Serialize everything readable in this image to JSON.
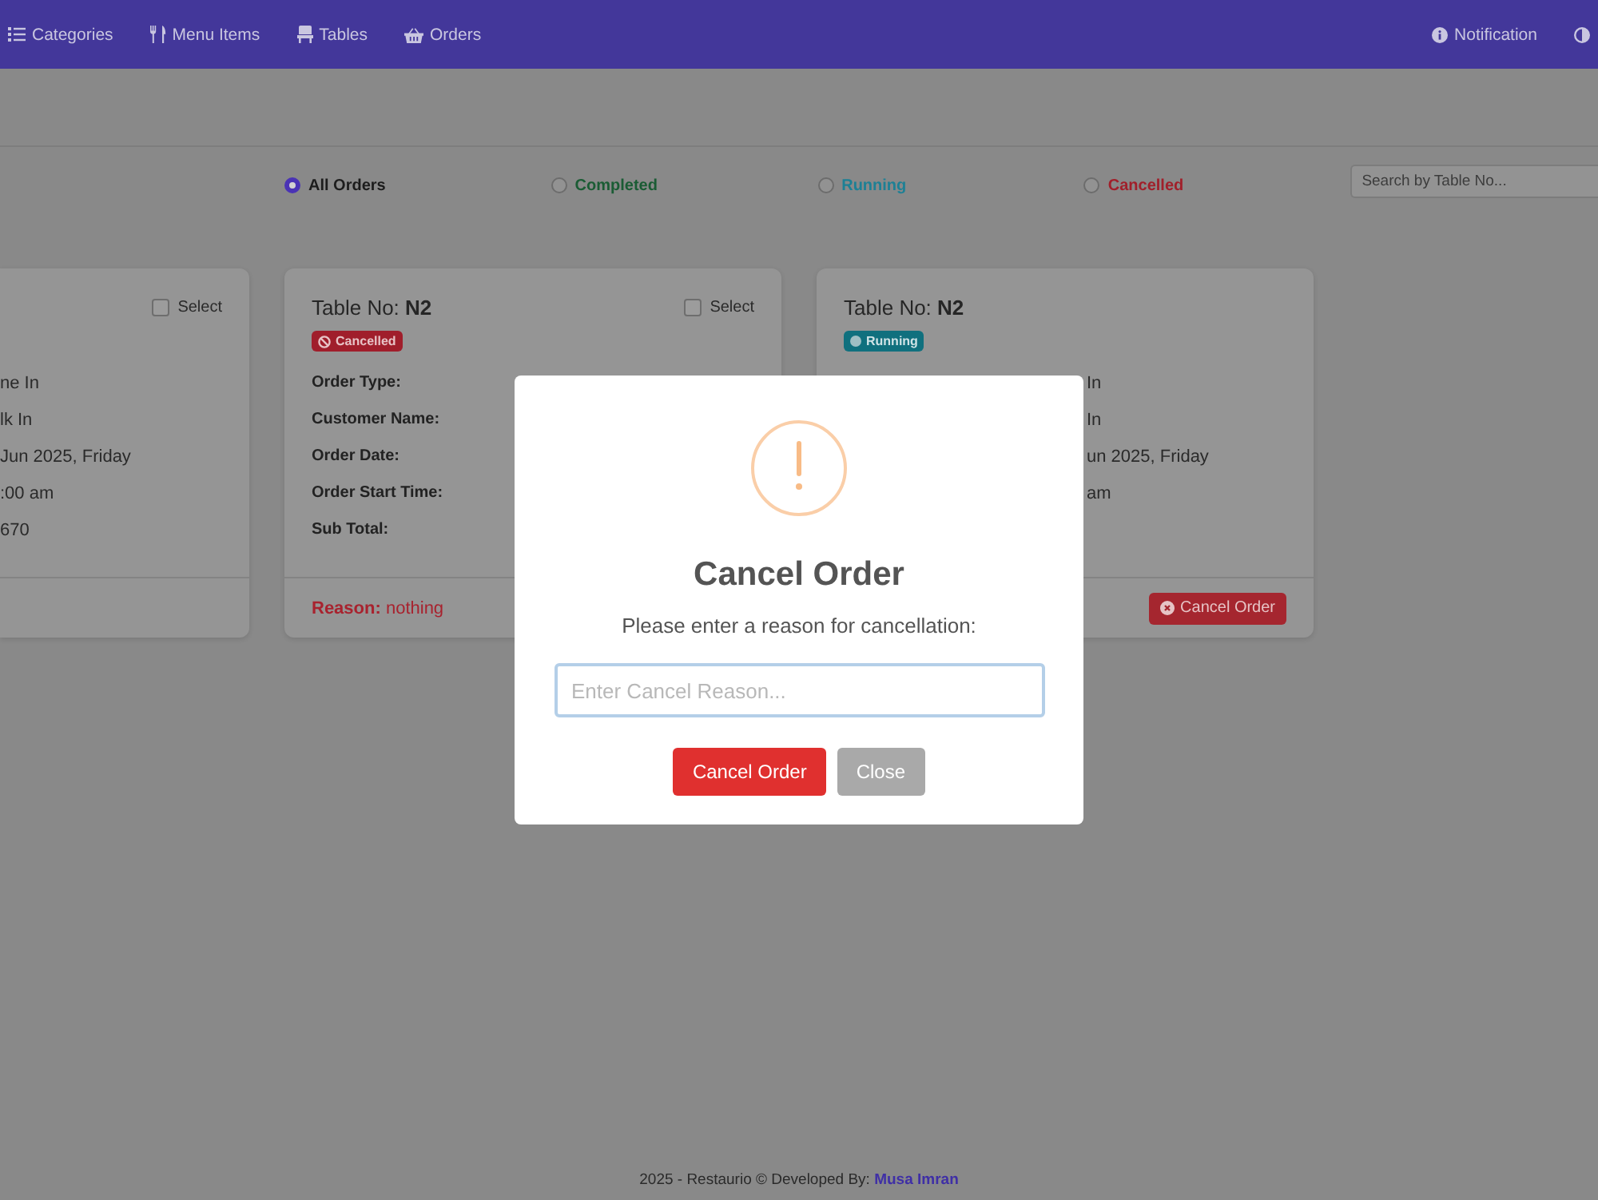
{
  "nav": {
    "items": [
      {
        "label": "Categories"
      },
      {
        "label": "Menu Items"
      },
      {
        "label": "Tables"
      },
      {
        "label": "Orders"
      }
    ],
    "right_items": [
      {
        "label": "Notification"
      }
    ]
  },
  "filters": {
    "options": [
      {
        "label": "All Orders",
        "selected": true,
        "color": "#1c1c1c"
      },
      {
        "label": "Completed",
        "selected": false,
        "color": "#1a5c34"
      },
      {
        "label": "Running",
        "selected": false,
        "color": "#1d8095"
      },
      {
        "label": "Cancelled",
        "selected": false,
        "color": "#a11f2a"
      }
    ],
    "search": {
      "placeholder": "Search by Table No..."
    }
  },
  "cards": [
    {
      "select": {
        "label": "Select",
        "checked": false
      },
      "details": [
        {
          "value": "ne In"
        },
        {
          "value": "lk In"
        },
        {
          "value": "Jun 2025, Friday"
        },
        {
          "value": ":00 am"
        },
        {
          "value": "670"
        }
      ]
    },
    {
      "title": "Table No: **N2**",
      "status": {
        "label": "Cancelled",
        "kind": "cancelled"
      },
      "select": {
        "label": "Select",
        "checked": false
      },
      "details": [
        {
          "label": "Order Type:"
        },
        {
          "label": "Customer Name:"
        },
        {
          "label": "Order Date:"
        },
        {
          "label": "Order Start Time:"
        },
        {
          "label": "Sub Total:"
        }
      ],
      "footer": {
        "kind": "reason",
        "text": "**Reason:** nothing"
      }
    },
    {
      "title": "Table No: **N2**",
      "status": {
        "label": "Running",
        "kind": "running"
      },
      "details": [
        {
          "value": "In"
        },
        {
          "value": "In"
        },
        {
          "value": "un 2025, Friday"
        },
        {
          "value": "am"
        }
      ],
      "footer": {
        "kind": "button",
        "label": "Cancel Order"
      }
    }
  ],
  "modal": {
    "title": "Cancel Order",
    "message": "Please enter a reason for cancellation:",
    "input": {
      "placeholder": "Enter Cancel Reason...",
      "focused": true
    },
    "buttons": [
      {
        "label": "Cancel Order",
        "kind": "confirm"
      },
      {
        "label": "Close",
        "kind": "close"
      }
    ]
  },
  "footer": {
    "text": "2025 - Restaurio © Developed By:",
    "link": "Musa Imran"
  }
}
